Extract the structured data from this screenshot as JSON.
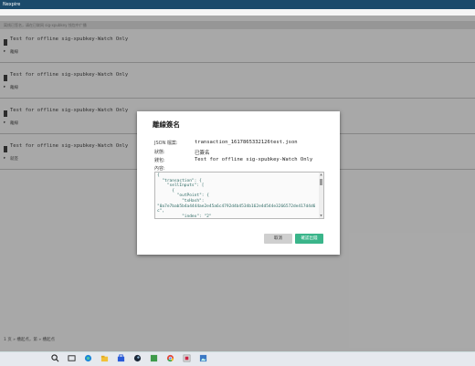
{
  "window": {
    "title": "Nexpire"
  },
  "info_bar": {
    "text": "离线已签名，请在已联网 sig-xpubkey 钱包中广播"
  },
  "items": [
    {
      "title": "Test for offline sig-xpubkey-Watch Only",
      "status": "離線"
    },
    {
      "title": "Test for offline sig-xpubkey-Watch Only",
      "status": "離線"
    },
    {
      "title": "Test for offline sig-xpubkey-Watch Only",
      "status": "離線"
    },
    {
      "title": "Test for offline sig-xpubkey-Watch Only",
      "status": "就签"
    }
  ],
  "footer": {
    "text": "1 页 » 槽起点，第 » 槽起点"
  },
  "modal": {
    "title": "離線簽名",
    "rows": [
      {
        "label": "JSON 檔案:",
        "value": "transaction_1617865332126test.json"
      },
      {
        "label": "狀態:",
        "value": "已簽名"
      },
      {
        "label": "錢包:",
        "value": "Test for offline sig-xpubkey-Watch Only"
      },
      {
        "label": "內容:",
        "value": ""
      }
    ],
    "content": "{\n  \"transaction\": {\n    \"sellInputs\": [\n      {\n        \"outPoint\": {\n          \"txHash\":\n\"0a7e7bab5b4a4444ae2e45a6c4792d4b4534b162e4d544e3266572de417d4d6c\",\n          \"index\": \"2\"",
    "cancel_label": "取消",
    "confirm_label": "確認出錢"
  },
  "taskbar": {
    "icons": [
      "search-icon",
      "task-view-icon",
      "edge-icon",
      "file-explorer-icon",
      "store-icon",
      "steam-icon",
      "app-icon",
      "chrome-icon",
      "app-icon",
      "photos-icon"
    ]
  }
}
